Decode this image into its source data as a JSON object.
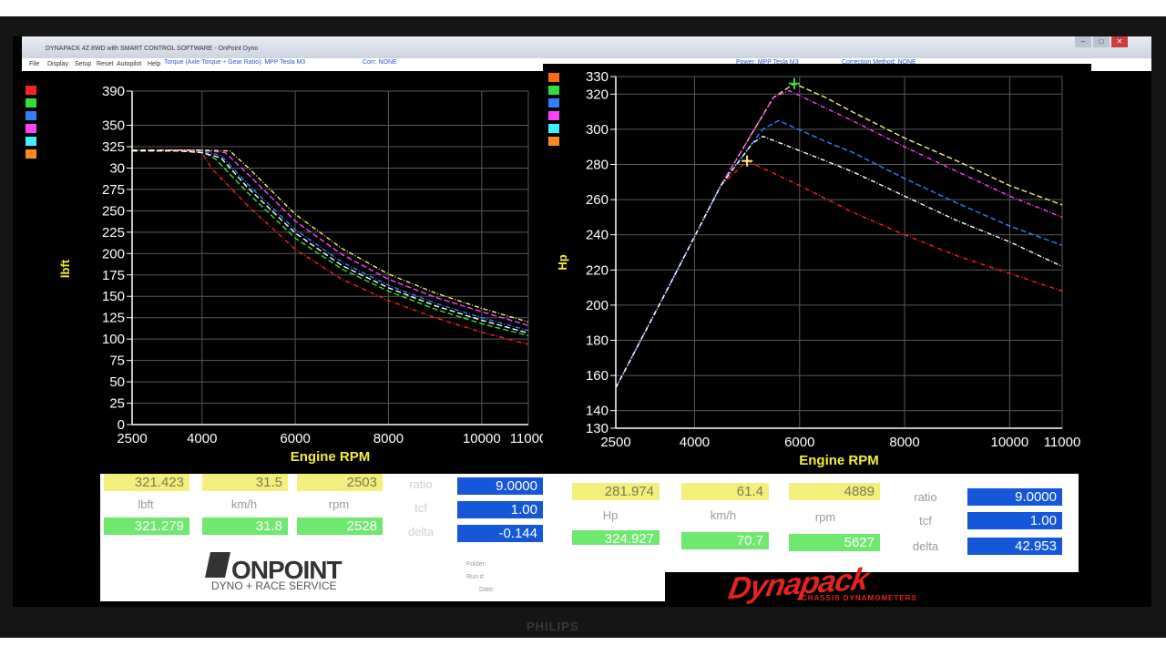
{
  "window": {
    "title": "DYNAPACK 4Z 8WD with SMART CONTROL SOFTWARE - OnPoint Dyno",
    "buttons": [
      "–",
      "□",
      "✕"
    ]
  },
  "menu": [
    "File",
    "Display",
    "Setup",
    "Reset",
    "Autopilot",
    "Help"
  ],
  "left_chart": {
    "header": "Torque (Axle Torque ÷ Gear Ratio): MPP Tesla M3",
    "corr": "Corr: NONE",
    "xlabel": "Engine RPM",
    "ylabel": "lbft",
    "colors": [
      "#ff2020",
      "#2ee03a",
      "#2f7fff",
      "#ff40ff",
      "#3ff0ff",
      "#ff8a1a"
    ]
  },
  "right_chart": {
    "header": "Power: MPP Tesla M3",
    "corr": "Correction Method: NONE",
    "xlabel": "Engine RPM",
    "ylabel": "Hp",
    "colors": [
      "#ff6a1a",
      "#2ee03a",
      "#2f7fff",
      "#ff40ff",
      "#3ff0ff",
      "#ff8a1a"
    ]
  },
  "chart_data": [
    {
      "type": "line",
      "xlabel": "Engine RPM",
      "ylabel": "lbft",
      "x_ticks": [
        "2500",
        "4000",
        "6000",
        "8000",
        "10000",
        "11000"
      ],
      "y_ticks": [
        "0",
        "25",
        "50",
        "75",
        "100",
        "125",
        "150",
        "175",
        "200",
        "225",
        "250",
        "275",
        "30",
        "325",
        "350",
        "390"
      ],
      "xlim": [
        2500,
        11000
      ],
      "ylim": [
        0,
        390
      ],
      "grid": true,
      "series": [
        {
          "color": "#ff2020",
          "x": [
            2500,
            3500,
            4000,
            4200,
            5000,
            6000,
            7000,
            8000,
            9000,
            10000,
            11000
          ],
          "y": [
            321,
            321,
            318,
            300,
            255,
            205,
            170,
            145,
            125,
            108,
            94
          ]
        },
        {
          "color": "#2ee03a",
          "x": [
            2500,
            3500,
            4000,
            4300,
            5000,
            6000,
            7000,
            8000,
            9000,
            10000,
            11000
          ],
          "y": [
            321,
            321,
            320,
            310,
            270,
            218,
            182,
            156,
            135,
            118,
            104
          ]
        },
        {
          "color": "#2f7fff",
          "x": [
            2500,
            3500,
            4000,
            4400,
            5000,
            6000,
            7000,
            8000,
            9000,
            10000,
            11000
          ],
          "y": [
            321,
            321,
            320,
            315,
            280,
            228,
            190,
            163,
            142,
            125,
            110
          ]
        },
        {
          "color": "#ff40ff",
          "x": [
            2500,
            3500,
            4000,
            4500,
            5000,
            6000,
            7000,
            8000,
            9000,
            10000,
            11000
          ],
          "y": [
            321,
            321,
            321,
            318,
            292,
            238,
            199,
            170,
            149,
            132,
            116
          ]
        },
        {
          "color": "#f4ee7c",
          "x": [
            2500,
            3500,
            4000,
            4600,
            5000,
            6000,
            7000,
            8000,
            9000,
            10000,
            11000
          ],
          "y": [
            321,
            321,
            321,
            320,
            300,
            246,
            206,
            176,
            154,
            136,
            120
          ]
        },
        {
          "color": "#ffffff",
          "x": [
            2500,
            3500,
            4000,
            4400,
            5000,
            6000,
            7000,
            8000,
            9000,
            10000,
            11000
          ],
          "y": [
            320,
            320,
            318,
            312,
            276,
            224,
            186,
            160,
            139,
            122,
            107
          ]
        }
      ]
    },
    {
      "type": "line",
      "xlabel": "Engine RPM",
      "ylabel": "Hp",
      "x_ticks": [
        "2500",
        "4000",
        "6000",
        "8000",
        "10000",
        "11000"
      ],
      "y_ticks": [
        "130",
        "140",
        "160",
        "180",
        "200",
        "220",
        "240",
        "260",
        "280",
        "300",
        "320",
        "330"
      ],
      "xlim": [
        2500,
        11000
      ],
      "ylim": [
        130,
        330
      ],
      "grid": true,
      "series": [
        {
          "color": "#ff2020",
          "x": [
            2500,
            3500,
            4500,
            5000,
            6000,
            7000,
            8000,
            9000,
            10000,
            11000
          ],
          "y": [
            153,
            210,
            268,
            282,
            268,
            253,
            240,
            228,
            218,
            208
          ]
        },
        {
          "color": "#f4ee7c",
          "x": [
            2500,
            3500,
            4500,
            5500,
            5900,
            6500,
            7000,
            8000,
            9000,
            10000,
            11000
          ],
          "y": [
            153,
            210,
            268,
            318,
            326,
            318,
            310,
            295,
            282,
            268,
            257
          ]
        },
        {
          "color": "#ff40ff",
          "x": [
            2500,
            3500,
            4500,
            5500,
            5800,
            6500,
            7000,
            8000,
            9000,
            10000,
            11000
          ],
          "y": [
            153,
            210,
            268,
            318,
            322,
            312,
            305,
            290,
            276,
            262,
            250
          ]
        },
        {
          "color": "#2f7fff",
          "x": [
            2500,
            3500,
            4500,
            5300,
            5600,
            6500,
            7000,
            8000,
            9000,
            10000,
            11000
          ],
          "y": [
            153,
            210,
            268,
            300,
            305,
            293,
            287,
            272,
            258,
            245,
            234
          ]
        },
        {
          "color": "#ffffff",
          "x": [
            2500,
            3500,
            4500,
            5100,
            5300,
            6500,
            7000,
            8000,
            9000,
            10000,
            11000
          ],
          "y": [
            153,
            210,
            268,
            292,
            296,
            282,
            276,
            262,
            248,
            236,
            222
          ]
        }
      ]
    }
  ],
  "left_readouts": {
    "top": [
      "321.423",
      "31.5",
      "2503"
    ],
    "labels": [
      "lbft",
      "km/h",
      "rpm"
    ],
    "bottom": [
      "321.279",
      "31.8",
      "2528"
    ],
    "side_labels": [
      "ratio",
      "tcf",
      "delta"
    ],
    "side_values": [
      "9.0000",
      "1.00",
      "-0.144"
    ]
  },
  "right_readouts": {
    "top": [
      "281.974",
      "61.4",
      "4889"
    ],
    "labels": [
      "Hp",
      "km/h",
      "rpm"
    ],
    "bottom": [
      "324.927",
      "70.7",
      "5627"
    ],
    "side_labels": [
      "ratio",
      "tcf",
      "delta"
    ],
    "side_values": [
      "9.0000",
      "1.00",
      "42.953"
    ]
  },
  "branding": {
    "onpoint": "ONPOINT",
    "onpoint_sub": "DYNO + RACE SERVICE",
    "dynapack": "Dynapack",
    "dynapack_sub": "CHASSIS DYNAMOMETERS",
    "monitor": "PHILIPS"
  },
  "info": [
    "Folder:",
    "Run #:",
    "Date:"
  ]
}
